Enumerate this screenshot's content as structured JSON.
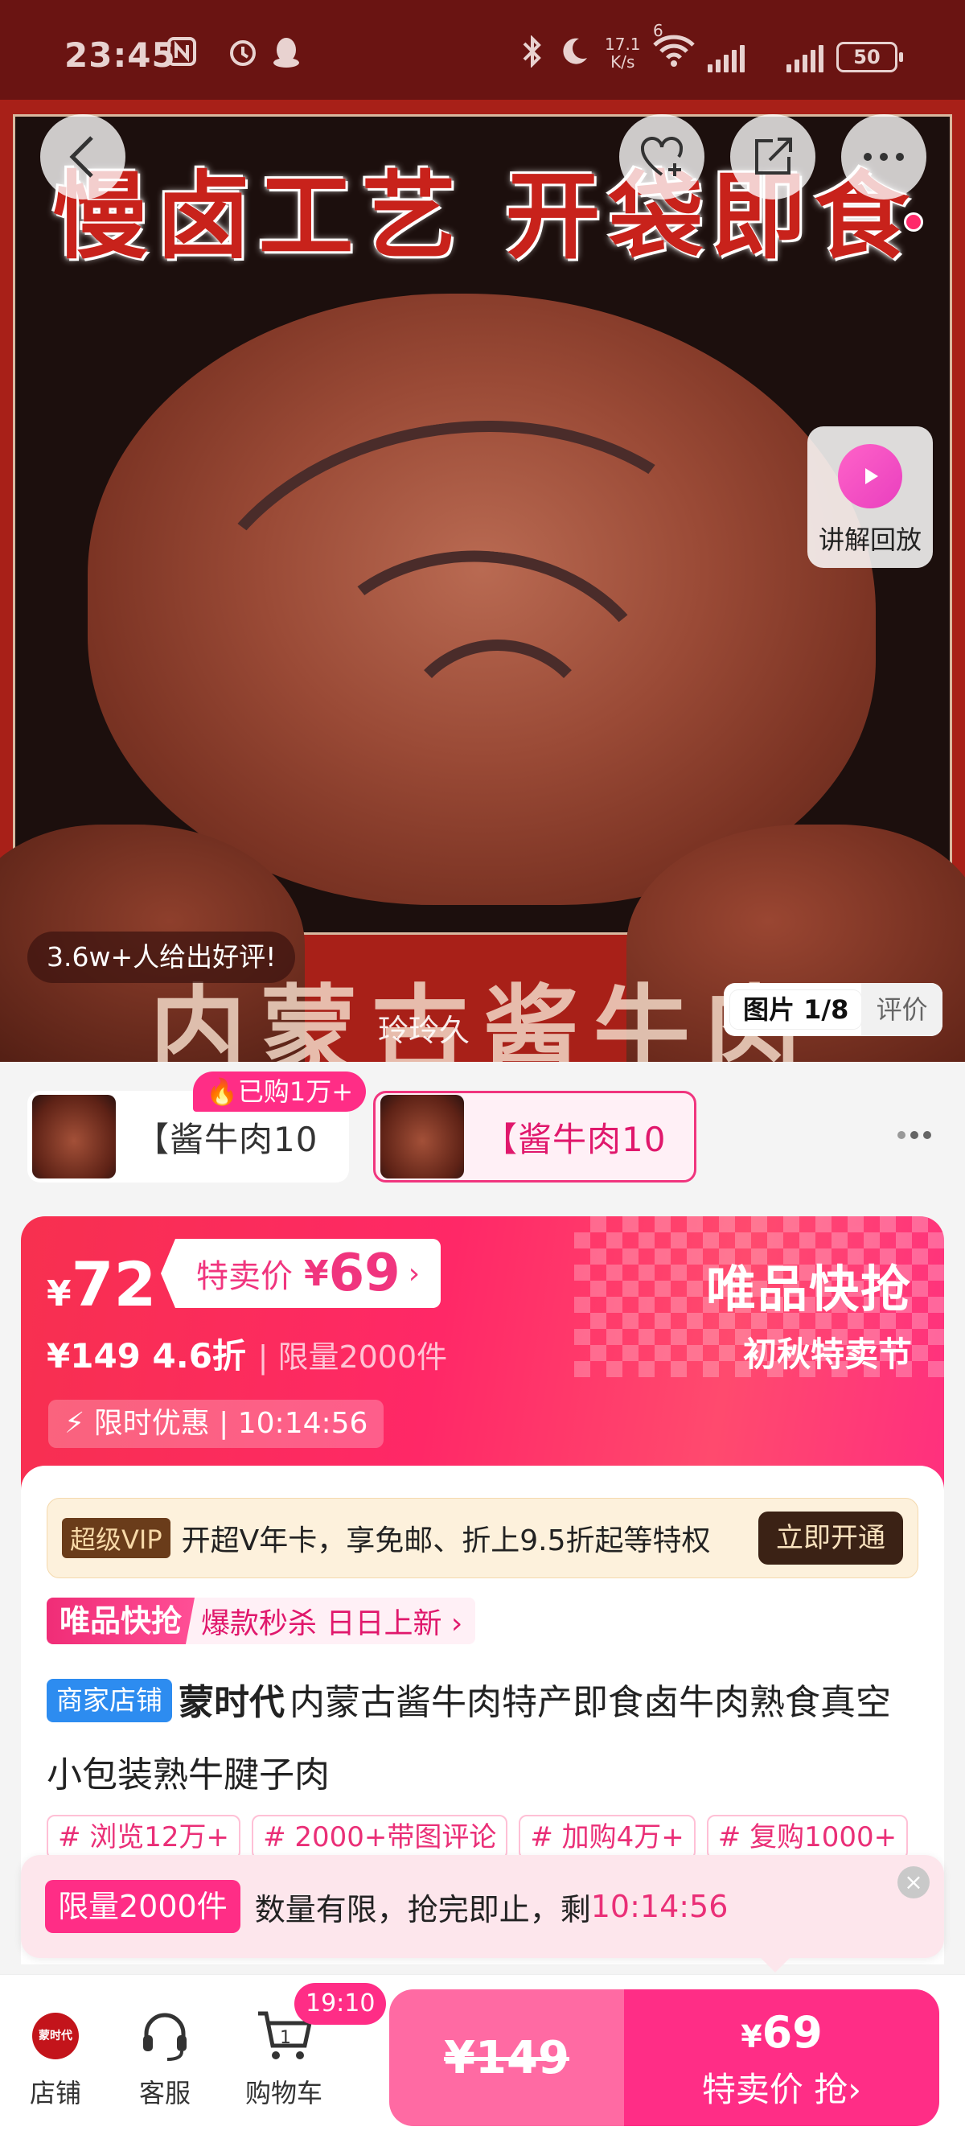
{
  "status_bar": {
    "time": "23:45",
    "net_speed_value": "17.1",
    "net_speed_unit": "K/s",
    "signal_label": "6",
    "battery": "50"
  },
  "hero": {
    "banner_text": "慢卤工艺 开袋即食",
    "product_title_text": "内蒙古酱牛肉",
    "watermark": "玲玲久",
    "review_pill": "3.6w+人给出好评!",
    "replay_label": "讲解回放",
    "image_counter": "图片 1/8",
    "review_tab": "评价"
  },
  "skus": {
    "items": [
      {
        "label": "【酱牛肉10"
      },
      {
        "label": "【酱牛肉10"
      }
    ],
    "bought_badge": "已购1万+"
  },
  "price": {
    "currency": "¥",
    "current": "72",
    "special_label": "特卖价",
    "special_value": "69",
    "original": "¥149",
    "discount": "4.6折",
    "limit_text": "| 限量2000件",
    "flash_label": "限时优惠 | 10:14:56",
    "brand_title": "唯品快抢",
    "brand_subtitle": "初秋特卖节"
  },
  "vip": {
    "badge": "超级VIP",
    "text": "开超V年卡，享免邮、折上9.5折起等特权",
    "button": "立即开通"
  },
  "promo": {
    "label": "唯品快抢",
    "text": "爆款秒杀 日日上新 ›"
  },
  "product": {
    "shop_badge": "商家店铺",
    "brand": "蒙时代",
    "title": "内蒙古酱牛肉特产即食卤牛肉熟食真空小包装熟牛腱子肉"
  },
  "tags": [
    "# 浏览12万+",
    "# 2000+带图评论",
    "# 加购4万+",
    "# 复购1000+"
  ],
  "limited_banner": {
    "label": "限量2000件",
    "text": "数量有限，抢完即止，剩",
    "countdown": "10:14:56"
  },
  "bottom_bar": {
    "shop_logo_text": "蒙时代",
    "shop_label": "店铺",
    "service_label": "客服",
    "cart_label": "购物车",
    "cart_count": "1",
    "cart_timer": "19:10",
    "buy_left_price": "¥149",
    "buy_right_currency": "¥",
    "buy_right_price": "69",
    "buy_right_action": "特卖价 抢›"
  },
  "colors": {
    "accent_pink": "#ff2d86",
    "hero_red": "#a82018",
    "status_bar": "#6a1412",
    "shop_badge_blue": "#2d8cf0"
  }
}
